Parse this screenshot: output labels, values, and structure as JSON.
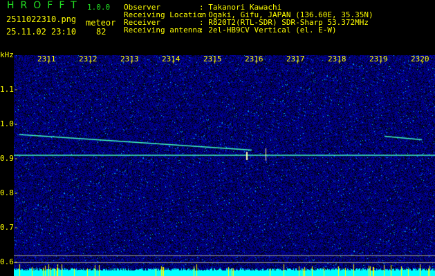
{
  "app": {
    "title": "HROFFT",
    "version": "1.0.0"
  },
  "file": {
    "name": "2511022310.png",
    "datetime": "25.11.02 23:10"
  },
  "meteor": {
    "label": "meteor",
    "count": "82"
  },
  "info": [
    {
      "label": "Observer",
      "value": ": Takanori Kawachi"
    },
    {
      "label": "Receiving Location",
      "value": ": Ogaki, Gifu, JAPAN (136.60E, 35.35N)"
    },
    {
      "label": "Receiver",
      "value": ": R820T2(RTL-SDR) SDR-Sharp 53.372MHz"
    },
    {
      "label": "Receiving antenna",
      "value": ": 2el-HB9CV Vertical (el. E-W)"
    }
  ],
  "colors": {
    "text": "#ffff00",
    "title": "#22dd22",
    "background": "#000000",
    "noise": "#1020c0",
    "echo": "#40ffc0",
    "power_bar": "#00ffff"
  },
  "chart_data": {
    "type": "heatmap",
    "ylabel": "kHz",
    "y_ticks": [
      "1.1",
      "1.0",
      "0.9",
      "0.8",
      "0.7",
      "0.6"
    ],
    "ylim": [
      0.56,
      1.2
    ],
    "x_ticks": [
      "2311",
      "2312",
      "2313",
      "2314",
      "2315",
      "2316",
      "2317",
      "2318",
      "2319",
      "2320"
    ],
    "xlim": [
      "2310",
      "2320"
    ],
    "features": [
      {
        "kind": "carrier",
        "freq_khz": 0.91,
        "x_start": "2310",
        "x_end": "2320"
      },
      {
        "kind": "meteor-trace",
        "start": {
          "time": "2310.3",
          "freq_khz": 0.97
        },
        "end": {
          "time": "2315.9",
          "freq_khz": 0.925
        }
      },
      {
        "kind": "meteor-trace",
        "start": {
          "time": "2319.1",
          "freq_khz": 0.965
        },
        "end": {
          "time": "2320",
          "freq_khz": 0.955
        }
      }
    ]
  }
}
